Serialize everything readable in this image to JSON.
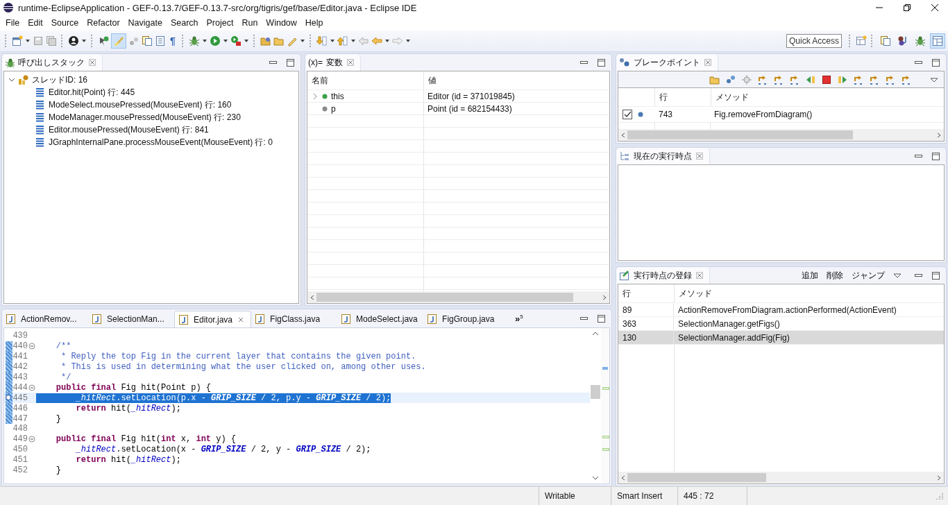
{
  "window": {
    "title": "runtime-EclipseApplication - GEF-0.13.7/GEF-0.13.7-src/org/tigris/gef/base/Editor.java - Eclipse IDE"
  },
  "menu": [
    "File",
    "Edit",
    "Source",
    "Refactor",
    "Navigate",
    "Search",
    "Project",
    "Run",
    "Window",
    "Help"
  ],
  "toolbar": {
    "mark_occurrences": {
      "on": true
    },
    "pilcrow": "¶",
    "quick_access": {
      "placeholder": "Quick Access"
    },
    "perspectives": [
      {
        "selected": false
      },
      {
        "selected": false
      },
      {
        "selected": false
      },
      {
        "selected": true
      }
    ]
  },
  "call_stack": {
    "title": "呼び出しスタック",
    "thread": {
      "label": "スレッドID: 16",
      "expanded": true,
      "children": [
        {
          "label": "Editor.hit(Point) 行: 445"
        },
        {
          "label": "ModeSelect.mousePressed(MouseEvent) 行: 160"
        },
        {
          "label": "ModeManager.mousePressed(MouseEvent) 行: 230"
        },
        {
          "label": "Editor.mousePressed(MouseEvent) 行: 841"
        },
        {
          "label": "JGraphInternalPane.processMouseEvent(MouseEvent) 行: 0"
        }
      ]
    }
  },
  "variables": {
    "title_icon": "(x)=",
    "title": "変数",
    "columns": [
      "名前",
      "値"
    ],
    "rows": [
      {
        "kind": "object",
        "name": "this",
        "value": "Editor (id = 371019845)"
      },
      {
        "kind": "local",
        "name": "p",
        "value": "Point (id = 682154433)"
      }
    ]
  },
  "breakpoints": {
    "title": "ブレークポイント",
    "columns": [
      "行",
      "メソッド"
    ],
    "rows": [
      {
        "checked": true,
        "line": "743",
        "method": "Fig.removeFromDiagram()"
      }
    ]
  },
  "current_point": {
    "title": "現在の実行時点"
  },
  "registration": {
    "title": "実行時点の登録",
    "actions": [
      "追加",
      "削除",
      "ジャンプ"
    ],
    "columns": [
      "行",
      "メソッド"
    ],
    "rows": [
      {
        "line": "89",
        "method": "ActionRemoveFromDiagram.actionPerformed(ActionEvent)",
        "selected": false
      },
      {
        "line": "363",
        "method": "SelectionManager.getFigs()",
        "selected": false
      },
      {
        "line": "130",
        "method": "SelectionManager.addFig(Fig)",
        "selected": true
      }
    ]
  },
  "editor": {
    "tabs": [
      {
        "label": "ActionRemov...",
        "selected": false
      },
      {
        "label": "SelectionMan...",
        "selected": false
      },
      {
        "label": "Editor.java",
        "selected": true
      },
      {
        "label": "FigClass.java",
        "selected": false
      },
      {
        "label": "ModeSelect.java",
        "selected": false
      },
      {
        "label": "FigGroup.java",
        "selected": false
      }
    ],
    "overflow": {
      "mark": "»",
      "count": "5"
    },
    "lines": [
      {
        "number": "439",
        "fold": false,
        "marked": false,
        "current": false
      },
      {
        "number": "440",
        "fold": true,
        "marked": true,
        "current": false,
        "tokens": [
          {
            "kind": "comment",
            "text": "    /**"
          }
        ]
      },
      {
        "number": "441",
        "fold": false,
        "marked": true,
        "current": false,
        "tokens": [
          {
            "kind": "comment",
            "text": "     * Reply the top Fig in the current layer that contains the given point."
          }
        ]
      },
      {
        "number": "442",
        "fold": false,
        "marked": true,
        "current": false,
        "tokens": [
          {
            "kind": "comment",
            "text": "     * This is used in determining what the user clicked on, among other uses."
          }
        ]
      },
      {
        "number": "443",
        "fold": false,
        "marked": true,
        "current": false,
        "tokens": [
          {
            "kind": "comment",
            "text": "     */"
          }
        ]
      },
      {
        "number": "444",
        "fold": true,
        "marked": true,
        "current": false,
        "tokens": [
          {
            "kind": "keyword",
            "text": "    public final"
          },
          {
            "kind": "plain",
            "text": " Fig hit(Point p) {"
          }
        ]
      },
      {
        "number": "445",
        "fold": false,
        "marked": true,
        "current": true,
        "tokens": [
          {
            "kind": "field",
            "text": "        _hitRect"
          },
          {
            "kind": "plain",
            "text": ".setLocation(p.x - "
          },
          {
            "kind": "constant",
            "text": "GRIP_SIZE"
          },
          {
            "kind": "plain",
            "text": " / 2, p.y - "
          },
          {
            "kind": "constant",
            "text": "GRIP_SIZE"
          },
          {
            "kind": "plain",
            "text": " / 2);"
          }
        ]
      },
      {
        "number": "446",
        "fold": false,
        "marked": true,
        "current": false,
        "tokens": [
          {
            "kind": "keyword",
            "text": "        return"
          },
          {
            "kind": "plain",
            "text": " hit("
          },
          {
            "kind": "field",
            "text": "_hitRect"
          },
          {
            "kind": "plain",
            "text": ");"
          }
        ]
      },
      {
        "number": "447",
        "fold": false,
        "marked": true,
        "current": false,
        "tokens": [
          {
            "kind": "plain",
            "text": "    }"
          }
        ]
      },
      {
        "number": "448",
        "fold": false,
        "marked": false,
        "current": false
      },
      {
        "number": "449",
        "fold": true,
        "marked": false,
        "current": false,
        "tokens": [
          {
            "kind": "keyword",
            "text": "    public final"
          },
          {
            "kind": "plain",
            "text": " Fig hit("
          },
          {
            "kind": "keyword",
            "text": "int"
          },
          {
            "kind": "plain",
            "text": " x, "
          },
          {
            "kind": "keyword",
            "text": "int"
          },
          {
            "kind": "plain",
            "text": " y) {"
          }
        ]
      },
      {
        "number": "450",
        "fold": false,
        "marked": false,
        "current": false,
        "tokens": [
          {
            "kind": "field",
            "text": "        _hitRect"
          },
          {
            "kind": "plain",
            "text": ".setLocation(x - "
          },
          {
            "kind": "constant",
            "text": "GRIP_SIZE"
          },
          {
            "kind": "plain",
            "text": " / 2, y - "
          },
          {
            "kind": "constant",
            "text": "GRIP_SIZE"
          },
          {
            "kind": "plain",
            "text": " / 2);"
          }
        ]
      },
      {
        "number": "451",
        "fold": false,
        "marked": false,
        "current": false,
        "tokens": [
          {
            "kind": "keyword",
            "text": "        return"
          },
          {
            "kind": "plain",
            "text": " hit("
          },
          {
            "kind": "field",
            "text": "_hitRect"
          },
          {
            "kind": "plain",
            "text": ");"
          }
        ]
      },
      {
        "number": "452",
        "fold": false,
        "marked": false,
        "current": false,
        "tokens": [
          {
            "kind": "plain",
            "text": "    }"
          }
        ]
      }
    ]
  },
  "status_bar": [
    "Writable",
    "Smart Insert",
    "445 : 72"
  ]
}
